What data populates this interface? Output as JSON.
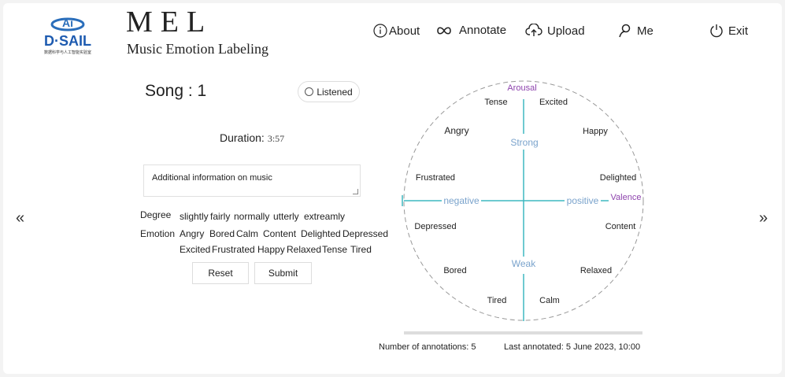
{
  "brand": {
    "title": "MEL",
    "subtitle": "Music Emotion Labeling",
    "logo_text": "D·SAIL",
    "logo_ai": "Ai",
    "logo_caption": "数据科学与人工智能实验室"
  },
  "nav": {
    "about": "About",
    "annotate": "Annotate",
    "upload": "Upload",
    "me": "Me",
    "exit": "Exit"
  },
  "song": {
    "title": "Song : 1",
    "listened_label": "Listened",
    "duration_label": "Duration:",
    "duration_value": "3:57",
    "info_text": "Additional information on music"
  },
  "degree": {
    "label": "Degree",
    "options": [
      "slightly",
      "fairly",
      "normally",
      "utterly",
      "extreamly"
    ]
  },
  "emotion": {
    "label": "Emotion",
    "options": [
      "Angry",
      "Bored",
      "Calm",
      "Content",
      "Delighted",
      "Depressed",
      "Excited",
      "Frustrated",
      "Happy",
      "Relaxed",
      "Tense",
      "Tired"
    ]
  },
  "buttons": {
    "reset": "Reset",
    "submit": "Submit"
  },
  "pager": {
    "prev": "«",
    "next": "»"
  },
  "circumplex": {
    "arousal": "Arousal",
    "valence": "Valence",
    "strong": "Strong",
    "weak": "Weak",
    "negative": "negative",
    "positive": "positive",
    "labels": {
      "tense": "Tense",
      "excited": "Excited",
      "angry": "Angry",
      "happy": "Happy",
      "frustrated": "Frustrated",
      "delighted": "Delighted",
      "depressed": "Depressed",
      "content": "Content",
      "bored": "Bored",
      "relaxed": "Relaxed",
      "tired": "Tired",
      "calm": "Calm"
    }
  },
  "footer": {
    "count": "Number of annotations: 5",
    "last": "Last annotated: 5 June 2023, 10:00"
  },
  "progress": 0.0,
  "colors": {
    "axis": "#3fb8c0",
    "axis_label": "#7aa3cc",
    "accent": "#8e44ad",
    "circle": "#999999"
  }
}
